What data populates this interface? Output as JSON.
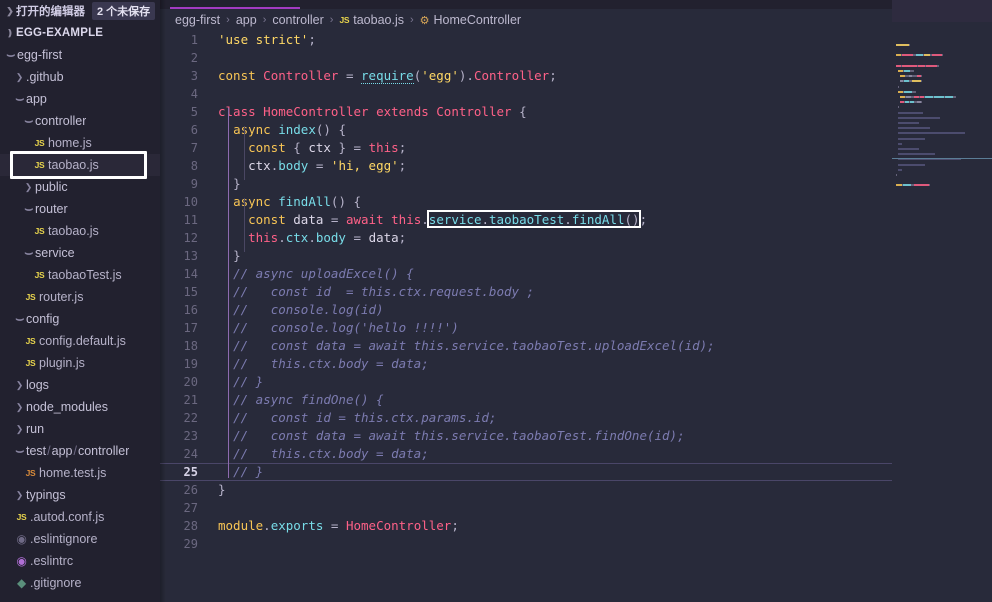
{
  "sidebar": {
    "open_editors": {
      "label": "打开的编辑器",
      "badge": "2 个未保存",
      "chevron": "chevron-right"
    },
    "root": {
      "label": "EGG-EXAMPLE",
      "chevron": "chevron-down"
    },
    "tree": [
      {
        "depth": 1,
        "type": "folder",
        "expanded": true,
        "label": "egg-first"
      },
      {
        "depth": 2,
        "type": "folder",
        "expanded": false,
        "label": ".github"
      },
      {
        "depth": 2,
        "type": "folder",
        "expanded": true,
        "label": "app"
      },
      {
        "depth": 3,
        "type": "folder",
        "expanded": true,
        "label": "controller"
      },
      {
        "depth": 4,
        "type": "file",
        "icon": "js",
        "label": "home.js"
      },
      {
        "depth": 4,
        "type": "file",
        "icon": "js",
        "label": "taobao.js",
        "selected": true
      },
      {
        "depth": 3,
        "type": "folder",
        "expanded": false,
        "label": "public"
      },
      {
        "depth": 3,
        "type": "folder",
        "expanded": true,
        "label": "router"
      },
      {
        "depth": 4,
        "type": "file",
        "icon": "js",
        "label": "taobao.js"
      },
      {
        "depth": 3,
        "type": "folder",
        "expanded": true,
        "label": "service"
      },
      {
        "depth": 4,
        "type": "file",
        "icon": "js",
        "label": "taobaoTest.js"
      },
      {
        "depth": 3,
        "type": "file",
        "icon": "js",
        "label": "router.js"
      },
      {
        "depth": 2,
        "type": "folder",
        "expanded": true,
        "label": "config"
      },
      {
        "depth": 3,
        "type": "file",
        "icon": "js",
        "label": "config.default.js"
      },
      {
        "depth": 3,
        "type": "file",
        "icon": "js",
        "label": "plugin.js"
      },
      {
        "depth": 2,
        "type": "folder",
        "expanded": false,
        "label": "logs"
      },
      {
        "depth": 2,
        "type": "folder",
        "expanded": false,
        "label": "node_modules"
      },
      {
        "depth": 2,
        "type": "folder",
        "expanded": false,
        "label": "run"
      },
      {
        "depth": 2,
        "type": "folder",
        "expanded": true,
        "label": "test / app / controller",
        "compact": true
      },
      {
        "depth": 3,
        "type": "file",
        "icon": "jstest",
        "label": "home.test.js"
      },
      {
        "depth": 2,
        "type": "folder",
        "expanded": false,
        "label": "typings"
      },
      {
        "depth": 2,
        "type": "file",
        "icon": "js",
        "label": ".autod.conf.js"
      },
      {
        "depth": 2,
        "type": "file",
        "icon": "cfg",
        "label": ".eslintignore"
      },
      {
        "depth": 2,
        "type": "file",
        "icon": "cfg-p",
        "label": ".eslintrc"
      },
      {
        "depth": 2,
        "type": "file",
        "icon": "git",
        "label": ".gitignore"
      }
    ]
  },
  "breadcrumb": {
    "items": [
      "egg-first",
      "app",
      "controller",
      "taobao.js",
      "HomeController"
    ],
    "separator": "›",
    "file_icon": "JS",
    "symbol_icon": "class-symbol"
  },
  "editor": {
    "active_line": 25,
    "total_lines": 29,
    "selection": {
      "line": 11,
      "text": "service.taobaoTest.findAll()"
    },
    "lines": [
      {
        "n": 1,
        "indent": 0,
        "text": "'use strict';"
      },
      {
        "n": 2,
        "indent": 0,
        "text": ""
      },
      {
        "n": 3,
        "indent": 0,
        "text": "const Controller = require('egg').Controller;"
      },
      {
        "n": 4,
        "indent": 0,
        "text": ""
      },
      {
        "n": 5,
        "indent": 0,
        "text": "class HomeController extends Controller {"
      },
      {
        "n": 6,
        "indent": 1,
        "text": "  async index() {"
      },
      {
        "n": 7,
        "indent": 2,
        "text": "    const { ctx } = this;"
      },
      {
        "n": 8,
        "indent": 2,
        "text": "    ctx.body = 'hi, egg';"
      },
      {
        "n": 9,
        "indent": 1,
        "text": "  }"
      },
      {
        "n": 10,
        "indent": 1,
        "text": "  async findAll() {"
      },
      {
        "n": 11,
        "indent": 2,
        "text": "    const data = await this.service.taobaoTest.findAll();"
      },
      {
        "n": 12,
        "indent": 2,
        "text": "    this.ctx.body = data;"
      },
      {
        "n": 13,
        "indent": 1,
        "text": "  }"
      },
      {
        "n": 14,
        "indent": 1,
        "text": "  // async uploadExcel() {"
      },
      {
        "n": 15,
        "indent": 1,
        "text": "  //   const id  = this.ctx.request.body ;"
      },
      {
        "n": 16,
        "indent": 1,
        "text": "  //   console.log(id)"
      },
      {
        "n": 17,
        "indent": 1,
        "text": "  //   console.log('hello !!!!')"
      },
      {
        "n": 18,
        "indent": 1,
        "text": "  //   const data = await this.service.taobaoTest.uploadExcel(id);"
      },
      {
        "n": 19,
        "indent": 1,
        "text": "  //   this.ctx.body = data;"
      },
      {
        "n": 20,
        "indent": 1,
        "text": "  // }"
      },
      {
        "n": 21,
        "indent": 1,
        "text": "  // async findOne() {"
      },
      {
        "n": 22,
        "indent": 1,
        "text": "  //   const id = this.ctx.params.id;"
      },
      {
        "n": 23,
        "indent": 1,
        "text": "  //   const data = await this.service.taobaoTest.findOne(id);"
      },
      {
        "n": 24,
        "indent": 1,
        "text": "  //   this.ctx.body = data;"
      },
      {
        "n": 25,
        "indent": 1,
        "text": "  // }"
      },
      {
        "n": 26,
        "indent": 0,
        "text": "}"
      },
      {
        "n": 27,
        "indent": 0,
        "text": ""
      },
      {
        "n": 28,
        "indent": 0,
        "text": "module.exports = HomeController;"
      },
      {
        "n": 29,
        "indent": 0,
        "text": ""
      }
    ]
  },
  "colors": {
    "editor_bg": "#282a3a",
    "sidebar_bg": "#22212f",
    "accent": "#a33bc2",
    "keyword": "#ff6188",
    "string": "#ffd866",
    "comment": "#7c7bb0",
    "function": "#78dce8",
    "const_kw": "#f8c555",
    "selection_border": "#ffffff"
  }
}
